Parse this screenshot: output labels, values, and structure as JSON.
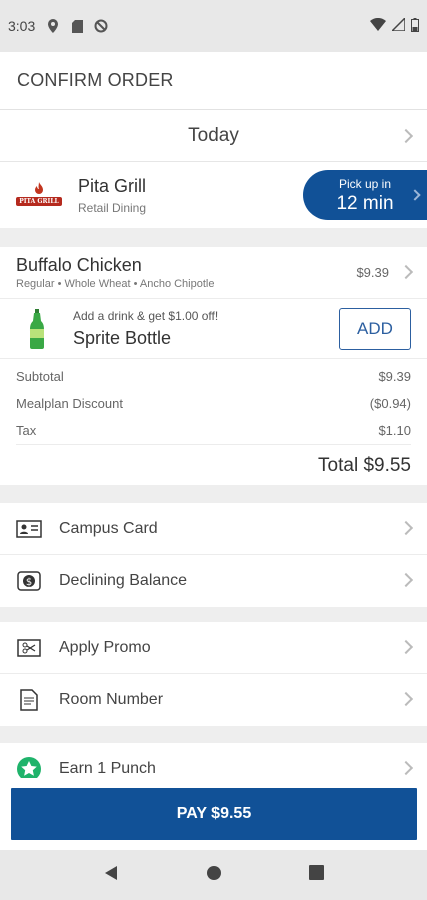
{
  "status_bar": {
    "time": "3:03",
    "icons": [
      "location-icon",
      "sd-card-icon",
      "no-sync-icon"
    ],
    "right_icons": [
      "wifi-icon",
      "signal-icon",
      "battery-icon"
    ]
  },
  "header": {
    "title": "CONFIRM ORDER"
  },
  "schedule": {
    "label": "Today"
  },
  "store": {
    "name": "Pita Grill",
    "type": "Retail Dining",
    "logo_text": "PITA GRILL",
    "pickup_label": "Pick up in",
    "pickup_time": "12 min"
  },
  "order_item": {
    "name": "Buffalo Chicken",
    "modifiers": "Regular • Whole Wheat • Ancho Chipotle",
    "price": "$9.39"
  },
  "upsell": {
    "hint": "Add a drink & get $1.00 off!",
    "name": "Sprite Bottle",
    "add_label": "ADD"
  },
  "summary": {
    "subtotal_label": "Subtotal",
    "subtotal_value": "$9.39",
    "discount_label": "Mealplan Discount",
    "discount_value": "($0.94)",
    "tax_label": "Tax",
    "tax_value": "$1.10",
    "total_label": "Total $9.55"
  },
  "payment_methods": [
    {
      "label": "Campus Card",
      "icon": "id-card-icon"
    },
    {
      "label": "Declining Balance",
      "icon": "dollar-badge-icon"
    }
  ],
  "extras": [
    {
      "label": "Apply Promo",
      "icon": "ticket-icon"
    },
    {
      "label": "Room Number",
      "icon": "document-icon"
    }
  ],
  "rewards": {
    "label": "Earn 1 Punch",
    "icon": "star-badge-icon"
  },
  "pay": {
    "label": "PAY $9.55"
  },
  "colors": {
    "primary": "#115197",
    "reward_green": "#1fb36b"
  }
}
